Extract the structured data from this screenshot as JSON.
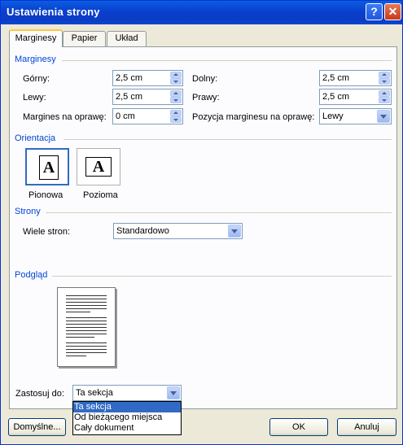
{
  "window": {
    "title": "Ustawienia strony",
    "help_icon": "?",
    "close_icon": "✕"
  },
  "tabs": [
    {
      "label": "Marginesy",
      "active": true
    },
    {
      "label": "Papier"
    },
    {
      "label": "Układ"
    }
  ],
  "margins": {
    "section_title": "Marginesy",
    "top": {
      "label": "Górny:",
      "value": "2,5 cm"
    },
    "bottom": {
      "label": "Dolny:",
      "value": "2,5 cm"
    },
    "left": {
      "label": "Lewy:",
      "value": "2,5 cm"
    },
    "right": {
      "label": "Prawy:",
      "value": "2,5 cm"
    },
    "gutter": {
      "label": "Margines na oprawę:",
      "value": "0 cm"
    },
    "gutter_position": {
      "label": "Pozycja marginesu na oprawę:",
      "value": "Lewy"
    }
  },
  "orientation": {
    "section_title": "Orientacja",
    "portrait": {
      "label": "Pionowa",
      "glyph": "A",
      "selected": true
    },
    "landscape": {
      "label": "Pozioma",
      "glyph": "A"
    }
  },
  "pages": {
    "section_title": "Strony",
    "multiple_label": "Wiele stron:",
    "multiple_value": "Standardowo"
  },
  "preview": {
    "section_title": "Podgląd"
  },
  "apply": {
    "label": "Zastosuj do:",
    "value": "Ta sekcja",
    "options": [
      "Ta sekcja",
      "Od bieżącego miejsca",
      "Cały dokument"
    ],
    "selected_index": 0
  },
  "buttons": {
    "default": "Domyślne...",
    "ok": "OK",
    "cancel": "Anuluj"
  },
  "colors": {
    "title_bar": "#0a5ee0",
    "group_title": "#0046d5",
    "selection": "#316ac5",
    "tab_highlight": "#ffc83c"
  }
}
